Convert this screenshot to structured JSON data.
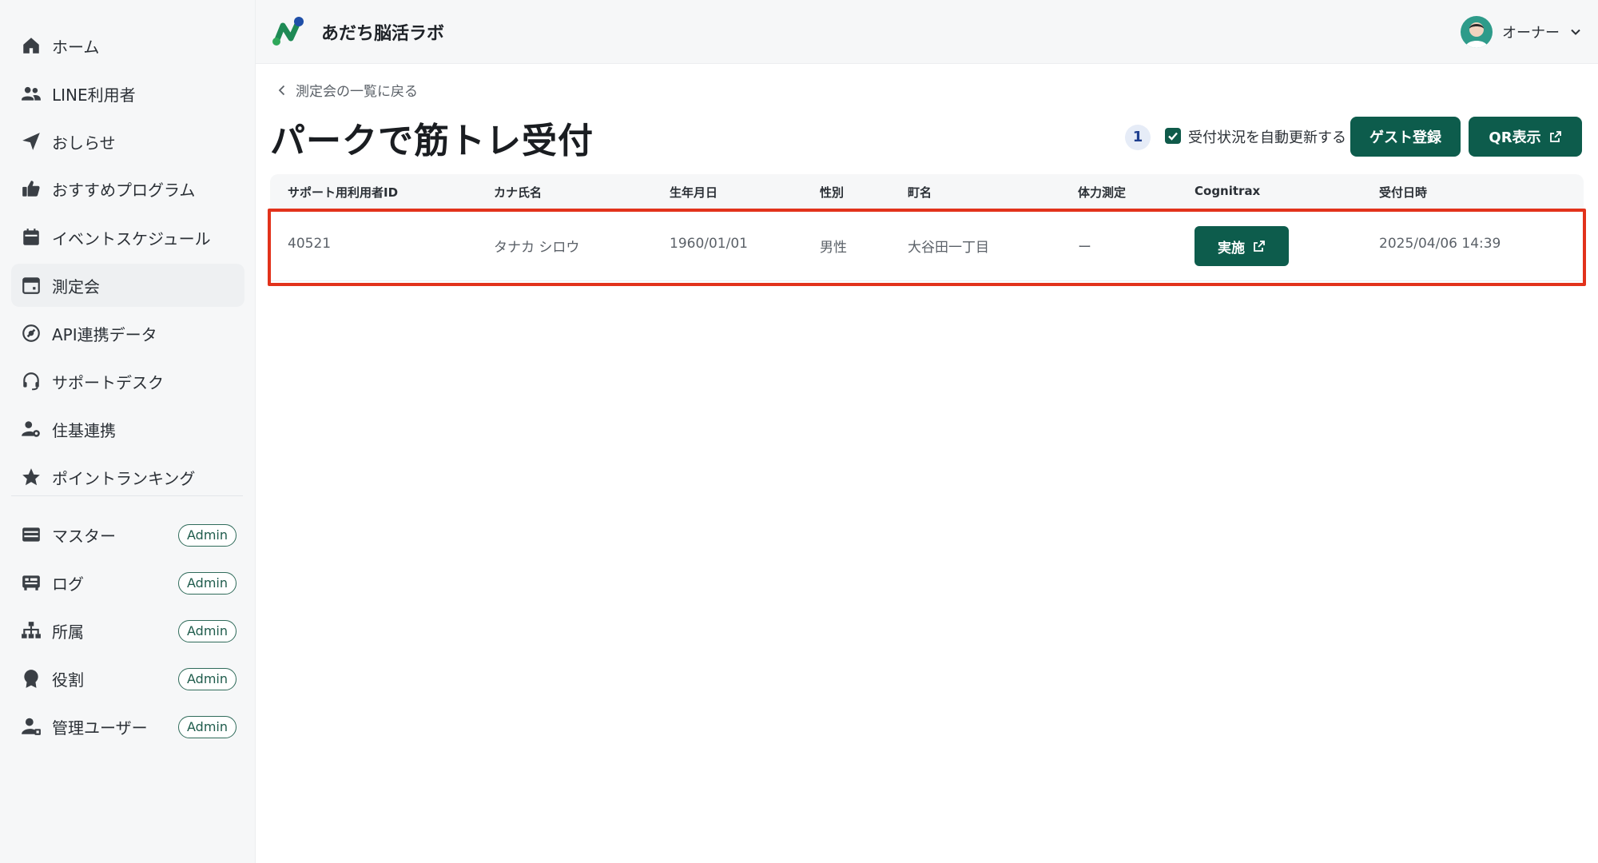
{
  "app": {
    "brand": "あだち脳活ラボ",
    "user_name": "オーナー"
  },
  "sidebar": {
    "items": [
      {
        "label": "ホーム",
        "icon": "home-icon"
      },
      {
        "label": "LINE利用者",
        "icon": "users-icon"
      },
      {
        "label": "おしらせ",
        "icon": "send-icon"
      },
      {
        "label": "おすすめプログラム",
        "icon": "thumbs-up-icon"
      },
      {
        "label": "イベントスケジュール",
        "icon": "calendar-icon"
      },
      {
        "label": "測定会",
        "icon": "calendar-blank-icon"
      },
      {
        "label": "API連携データ",
        "icon": "plug-icon"
      },
      {
        "label": "サポートデスク",
        "icon": "headset-icon"
      },
      {
        "label": "住基連携",
        "icon": "user-gear-icon"
      },
      {
        "label": "ポイントランキング",
        "icon": "star-icon"
      }
    ],
    "admin_items": [
      {
        "label": "マスター",
        "badge": "Admin",
        "icon": "database-icon"
      },
      {
        "label": "ログ",
        "badge": "Admin",
        "icon": "log-icon"
      },
      {
        "label": "所属",
        "badge": "Admin",
        "icon": "org-chart-icon"
      },
      {
        "label": "役割",
        "badge": "Admin",
        "icon": "award-icon"
      },
      {
        "label": "管理ユーザー",
        "badge": "Admin",
        "icon": "user-admin-icon"
      }
    ]
  },
  "main": {
    "back_label": "測定会の一覧に戻る",
    "title": "パークで筋トレ受付",
    "count": "1",
    "auto_update_label": "受付状況を自動更新する",
    "auto_update_checked": true,
    "guest_button": "ゲスト登録",
    "qr_button": "QR表示"
  },
  "table": {
    "columns": [
      "サポート用利用者ID",
      "カナ氏名",
      "生年月日",
      "性別",
      "町名",
      "体力測定",
      "Cognitrax",
      "受付日時"
    ],
    "rows": [
      {
        "id": "40521",
        "kana": "タナカ シロウ",
        "birth": "1960/01/01",
        "gender": "男性",
        "town": "大谷田一丁目",
        "fitness": "ー",
        "cognitrax_button": "実施",
        "received_at": "2025/04/06 14:39"
      }
    ]
  },
  "colors": {
    "primary": "#0d5c4c",
    "highlight": "#e2321b",
    "sidebar_bg": "#f6f7f8"
  }
}
